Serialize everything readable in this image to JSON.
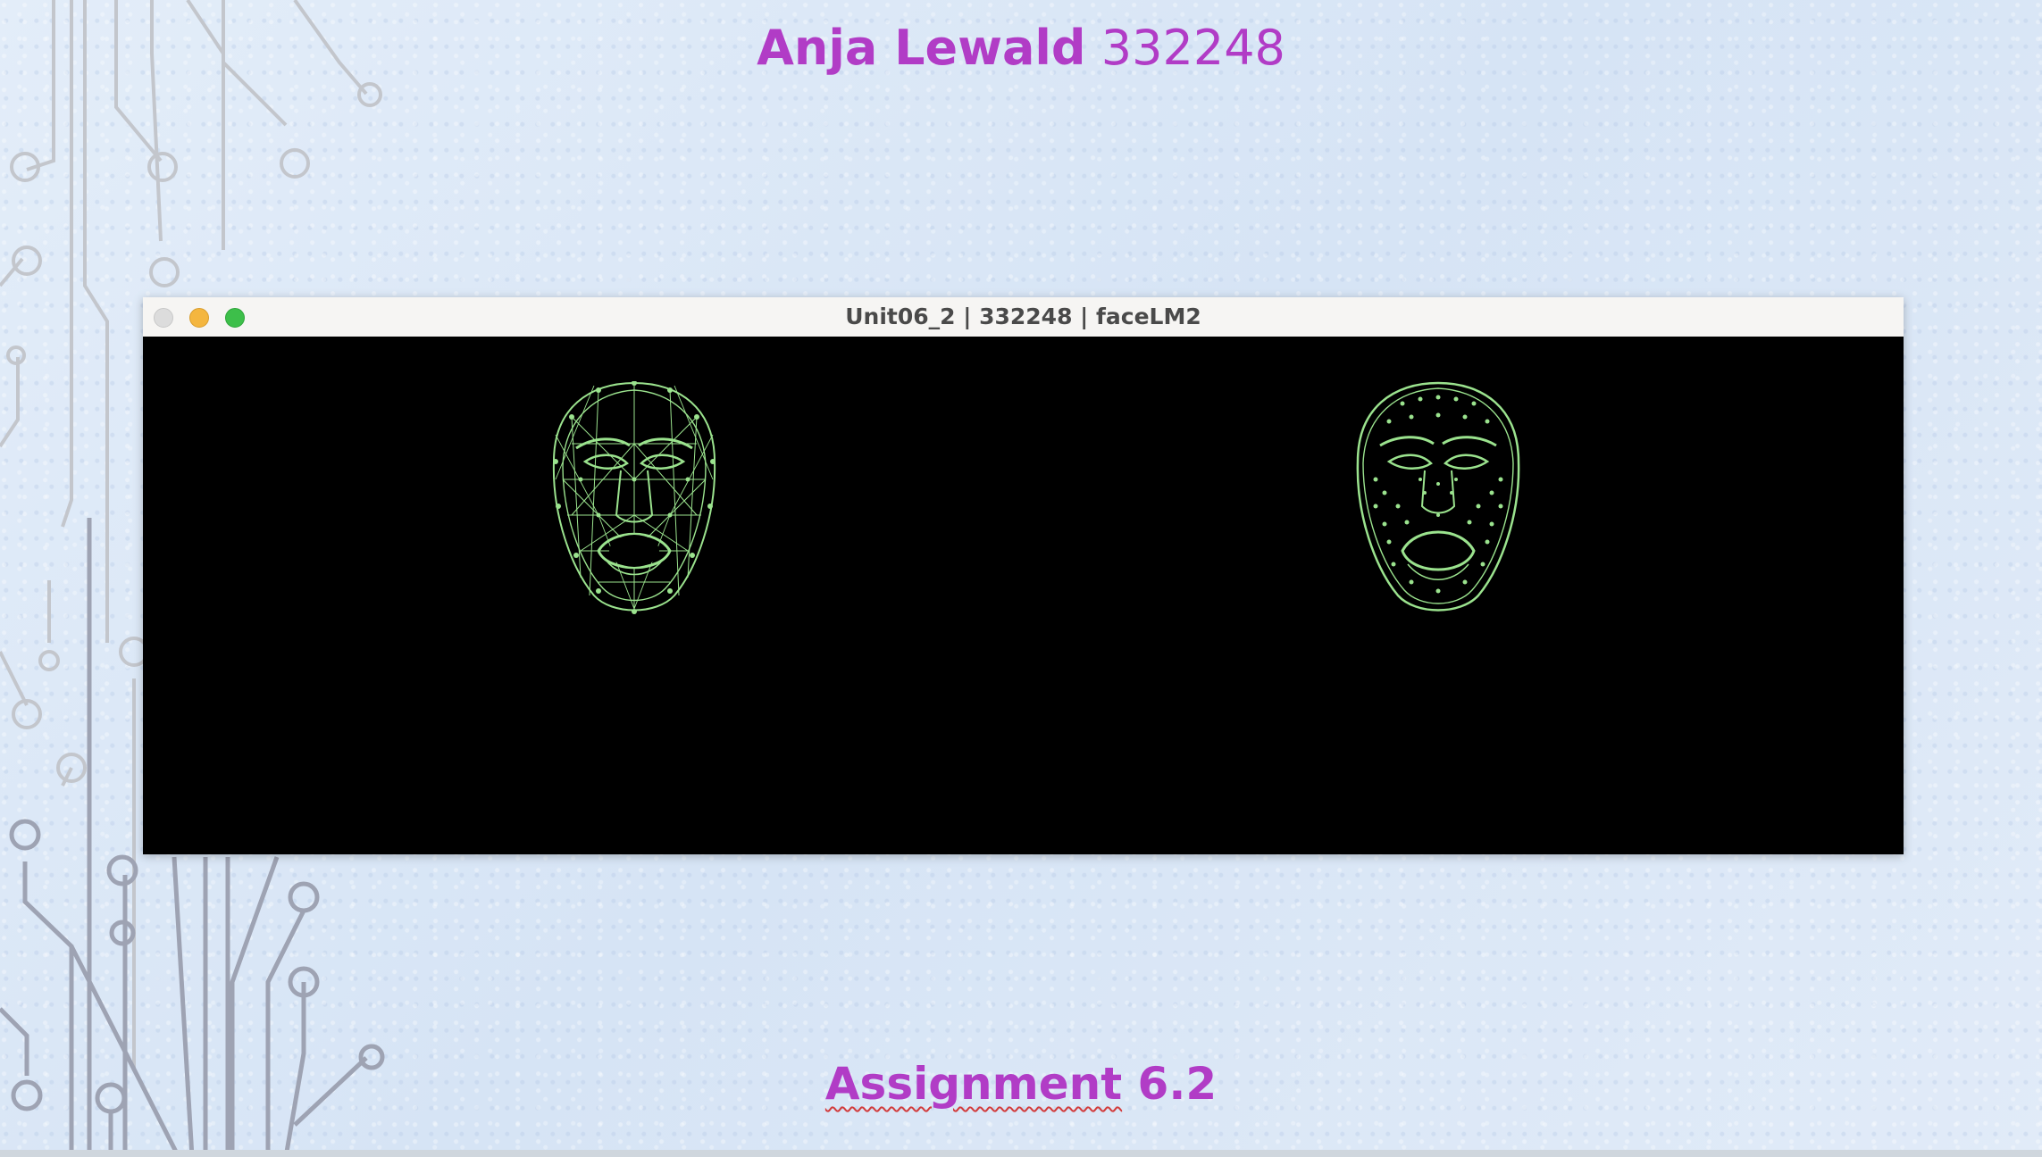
{
  "slide": {
    "title_name": "Anja Lewald",
    "title_number": "332248",
    "assignment_word": "Assignment",
    "assignment_number": "6.2"
  },
  "window": {
    "title": "Unit06_2 | 332248 | faceLM2"
  },
  "colors": {
    "accent_purple": "#b13cc6",
    "mesh_green": "#9be38e",
    "canvas_bg": "#000000"
  }
}
